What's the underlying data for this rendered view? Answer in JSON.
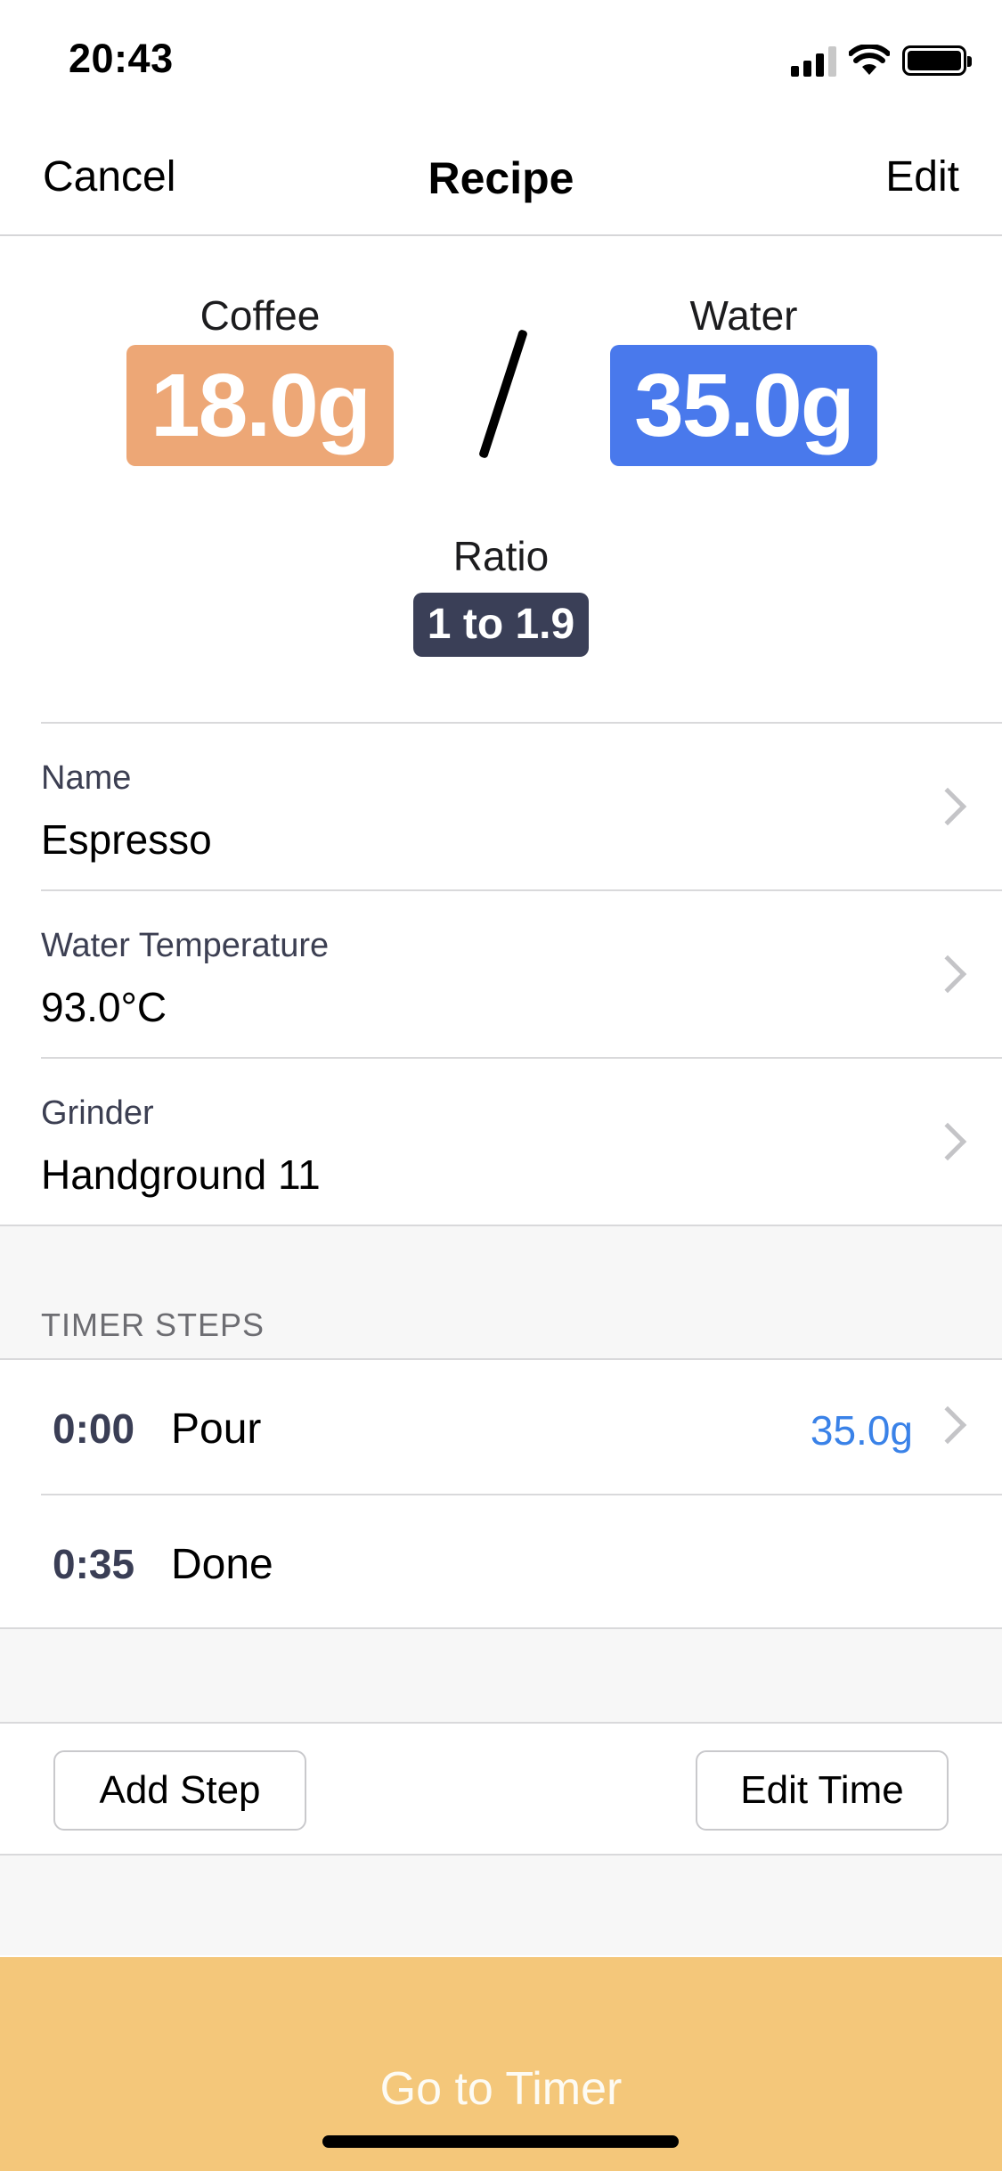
{
  "status_bar": {
    "time": "20:43",
    "signal_icon": "cellular-signal-icon",
    "wifi_icon": "wifi-icon",
    "battery_icon": "battery-icon"
  },
  "nav": {
    "cancel_label": "Cancel",
    "title": "Recipe",
    "edit_label": "Edit"
  },
  "ratio": {
    "coffee_label": "Coffee",
    "coffee_value": "18.0g",
    "separator": "/",
    "water_label": "Water",
    "water_value": "35.0g",
    "ratio_label": "Ratio",
    "ratio_value": "1 to 1.9"
  },
  "details": [
    {
      "label": "Name",
      "value": "Espresso"
    },
    {
      "label": "Water Temperature",
      "value": "93.0°C"
    },
    {
      "label": "Grinder",
      "value": "Handground 11"
    }
  ],
  "timer_steps": {
    "header": "TIMER STEPS",
    "steps": [
      {
        "time": "0:00",
        "name": "Pour",
        "amount": "35.0g"
      },
      {
        "time": "0:35",
        "name": "Done",
        "amount": ""
      }
    ]
  },
  "actions": {
    "add_step_label": "Add Step",
    "edit_time_label": "Edit Time",
    "go_to_timer_label": "Go to Timer"
  },
  "colors": {
    "coffee": "#EDA776",
    "water": "#4979EC",
    "ratio": "#3A3F57",
    "go_to_timer": "#F4C77A",
    "step_amount": "#3A82E8"
  }
}
